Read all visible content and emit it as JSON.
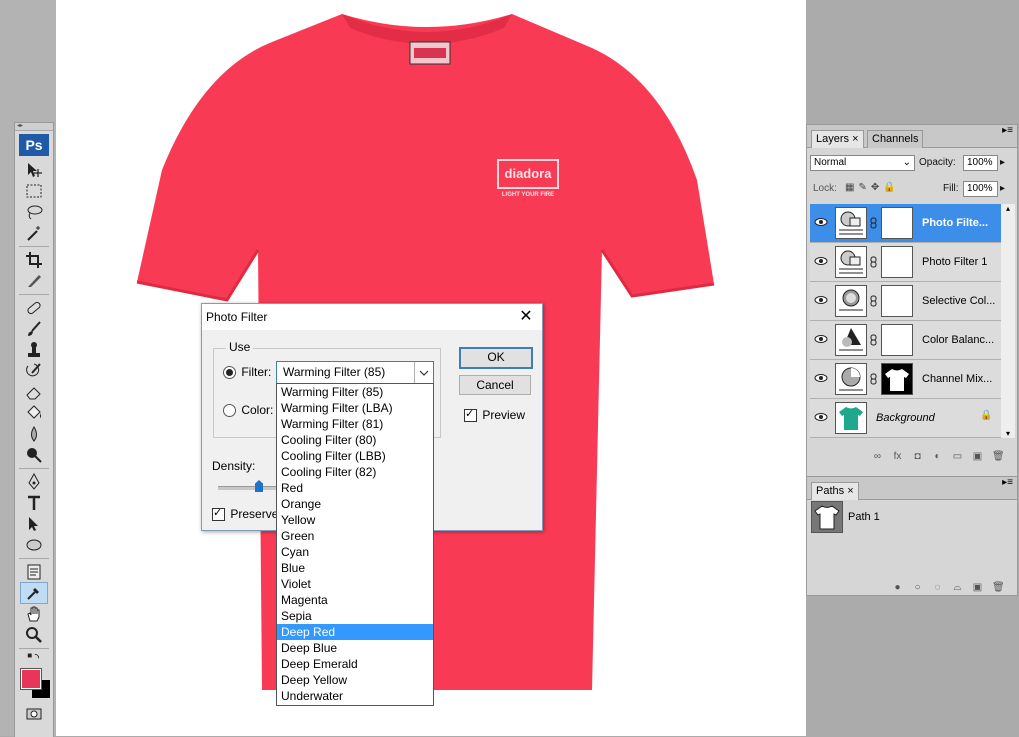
{
  "toolbox": {
    "logo": "Ps",
    "tools": [
      "move-tool",
      "marquee-tool",
      "lasso-tool",
      "magic-wand-tool",
      "crop-tool",
      "slice-tool",
      "healing-brush-tool",
      "brush-tool",
      "clone-stamp-tool",
      "history-brush-tool",
      "eraser-tool",
      "paint-bucket-tool",
      "blur-tool",
      "dodge-tool",
      "pen-tool",
      "type-tool",
      "path-selection-tool",
      "shape-tool",
      "notes-tool",
      "eyedropper-tool",
      "hand-tool",
      "zoom-tool"
    ],
    "active_tool": "eyedropper-tool",
    "foreground_color": "#e8365a",
    "background_color": "#000000"
  },
  "canvas": {
    "shirt_color": "#f93a55",
    "shirt_logo_text": "diadora",
    "shirt_logo_tagline": "LIGHT YOUR FIRE"
  },
  "dialog": {
    "title": "Photo Filter",
    "use_label": "Use",
    "filter_label": "Filter:",
    "color_label": "Color:",
    "filter_selected": "Warming Filter (85)",
    "density_label": "Density:",
    "preserve_label": "Preserve",
    "ok_label": "OK",
    "cancel_label": "Cancel",
    "preview_label": "Preview",
    "filter_options": [
      "Warming Filter (85)",
      "Warming Filter (LBA)",
      "Warming Filter (81)",
      "Cooling Filter (80)",
      "Cooling Filter (LBB)",
      "Cooling Filter (82)",
      "Red",
      "Orange",
      "Yellow",
      "Green",
      "Cyan",
      "Blue",
      "Violet",
      "Magenta",
      "Sepia",
      "Deep Red",
      "Deep Blue",
      "Deep Emerald",
      "Deep Yellow",
      "Underwater"
    ],
    "highlighted_option": "Deep Red"
  },
  "layers_panel": {
    "tab_layers": "Layers",
    "tab_channels": "Channels",
    "blend_mode": "Normal",
    "opacity_label": "Opacity:",
    "opacity_value": "100%",
    "lock_label": "Lock:",
    "fill_label": "Fill:",
    "fill_value": "100%",
    "layers": [
      {
        "name": "Photo Filte...",
        "selected": true
      },
      {
        "name": "Photo Filter 1",
        "selected": false
      },
      {
        "name": "Selective Col...",
        "selected": false
      },
      {
        "name": "Color Balanc...",
        "selected": false
      },
      {
        "name": "Channel Mix...",
        "selected": false
      },
      {
        "name": "Background",
        "selected": false
      }
    ]
  },
  "paths_panel": {
    "tab_paths": "Paths",
    "paths": [
      {
        "name": "Path 1"
      }
    ]
  }
}
